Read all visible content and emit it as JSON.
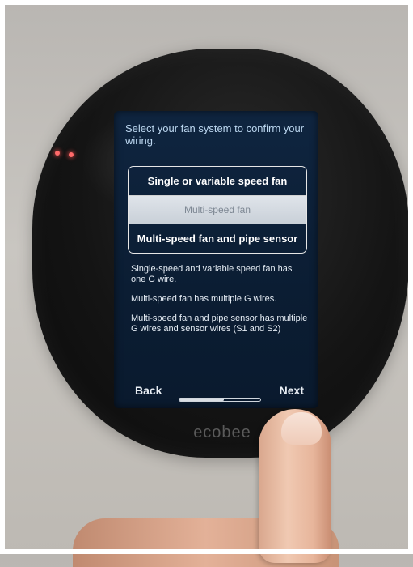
{
  "device": {
    "brand": "ecobee"
  },
  "screen": {
    "prompt": "Select your fan system to confirm your wiring.",
    "options": [
      {
        "label": "Single or variable speed fan",
        "selected": false
      },
      {
        "label": "Multi-speed fan",
        "selected": true
      },
      {
        "label": "Multi-speed fan and pipe sensor",
        "selected": false
      }
    ],
    "descriptions": [
      "Single-speed and variable speed fan has one G wire.",
      "Multi-speed fan has multiple G wires.",
      "Multi-speed fan and pipe sensor has multiple G wires and sensor wires (S1 and S2)"
    ],
    "nav": {
      "back_label": "Back",
      "next_label": "Next",
      "progress": 0.55
    }
  },
  "colors": {
    "screen_bg": "#0f2540",
    "selected_bg": "#d6dce3",
    "led": "#ff6a6a"
  }
}
